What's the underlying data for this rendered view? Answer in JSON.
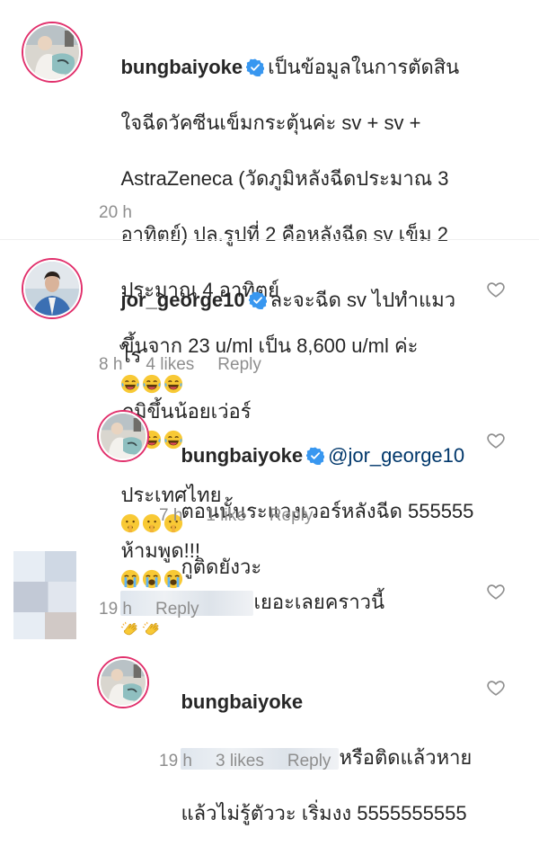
{
  "comments": [
    {
      "username": "bungbaiyoke",
      "text_lines": [
        "เป็นข้อมูลในการตัดสิน",
        "ใจฉีดวัคซีนเข็มกระตุ้นค่ะ sv + sv +",
        "AstraZeneca (วัดภูมิหลังฉีดประมาณ 3",
        "อาทิตย์) ปล.รูปที่ 2 คือหลังฉีด sv เข็ม 2",
        "ประมาณ 4 อาทิตย์",
        "ขึ้นจาก 23 u/ml เป็น 8,600 u/ml ค่ะ"
      ],
      "time": "20 h"
    },
    {
      "username": "jor_george10",
      "text_lines": [
        "ละจะฉีด sv ไปทำแมว",
        "ไร",
        "ภูมิขึ้นน้อยเว่อร์",
        "ประเทศไทย",
        "ห้ามพูด!!!"
      ],
      "time": "8 h",
      "likes": "4 likes",
      "reply": "Reply"
    },
    {
      "username": "bungbaiyoke",
      "mention": "@jor_george10",
      "text_lines": [
        "ตอนนั้นระแวงเวอร์หลังฉีด 555555",
        "กูติดยังวะ"
      ],
      "time": "7 h",
      "likes": "1 like",
      "reply": "Reply"
    },
    {
      "text_lines": [
        "เยอะเลยคราวนี้"
      ],
      "time": "19 h",
      "reply": "Reply"
    },
    {
      "username": "bungbaiyoke",
      "text_lines": [
        "หรือติดแล้วหาย",
        "แล้วไม่รู้ตัววะ เริ่มงง 5555555555"
      ],
      "time": "19 h",
      "likes": "3 likes",
      "reply": "Reply"
    }
  ],
  "icons": {
    "verified": "verified-badge-icon",
    "like": "heart-outline-icon",
    "laugh": "face-with-tears-of-joy-icon",
    "shush": "shushing-face-icon",
    "cry": "loudly-crying-face-icon",
    "clap": "clapping-hands-icon"
  },
  "colors": {
    "verified": "#3897f0",
    "meta": "#8e8e8e",
    "mention": "#00376b",
    "text": "#262626"
  }
}
